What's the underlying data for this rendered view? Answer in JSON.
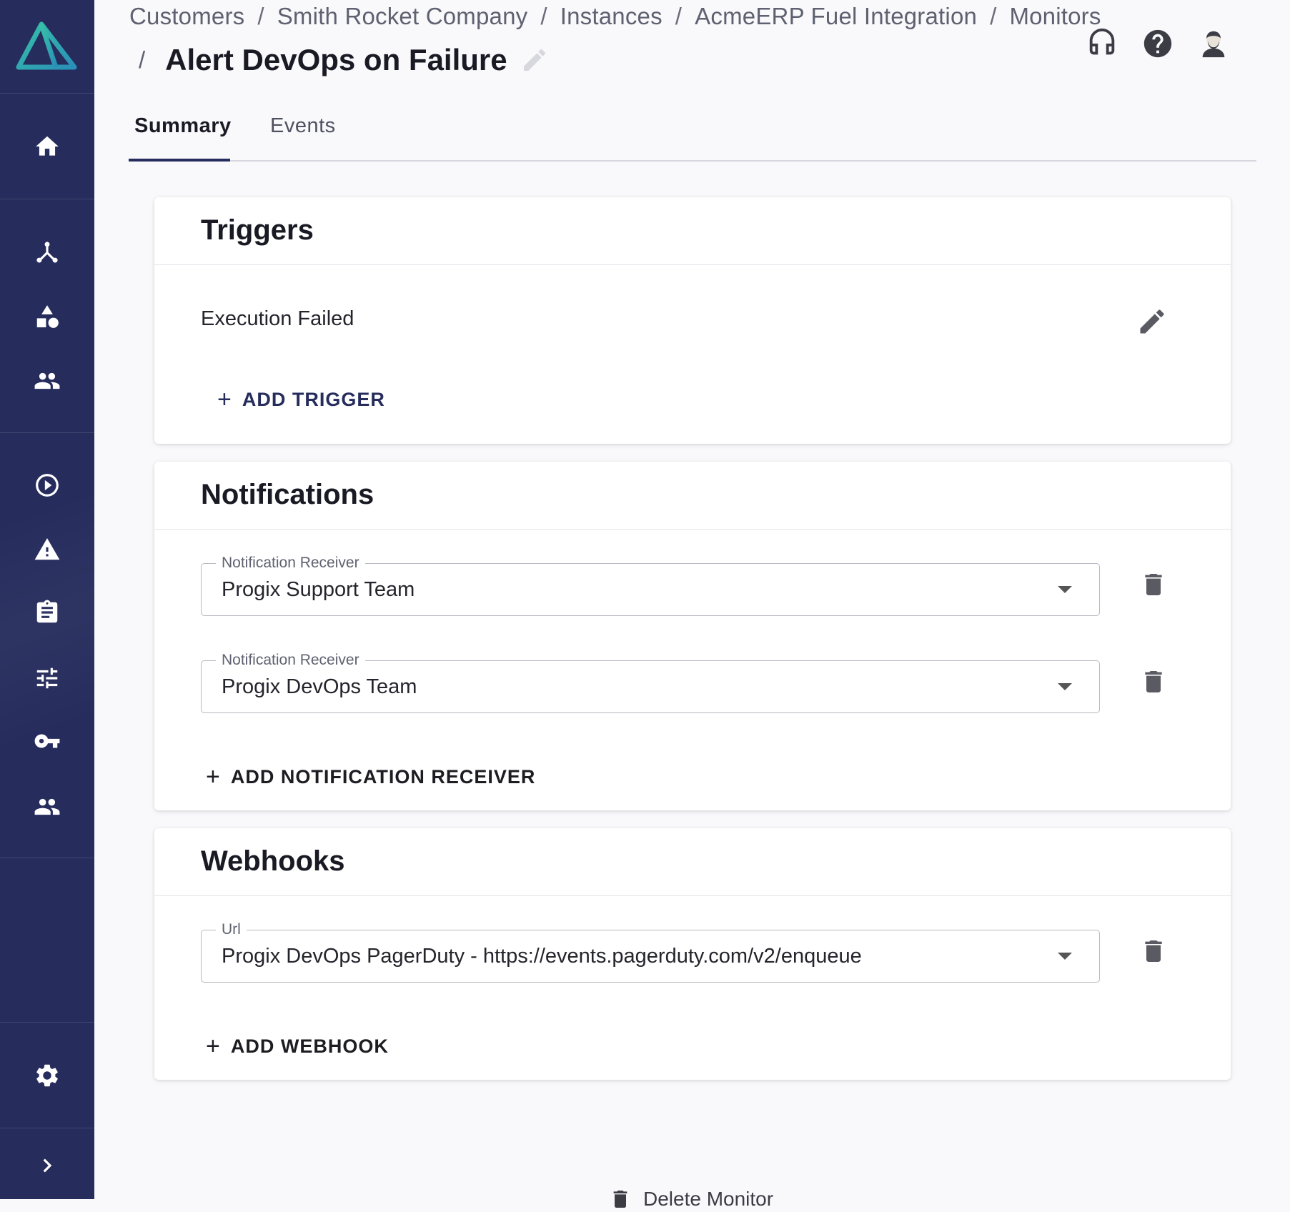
{
  "sidebar": {
    "logo": "prismatic-logo",
    "items": [
      {
        "name": "home",
        "icon": "home-icon"
      },
      {
        "name": "integrations",
        "icon": "integrations-icon"
      },
      {
        "name": "components",
        "icon": "shapes-icon"
      },
      {
        "name": "customers",
        "icon": "people-icon"
      },
      {
        "name": "executions",
        "icon": "play-circle-icon"
      },
      {
        "name": "alerts",
        "icon": "warning-icon"
      },
      {
        "name": "logs",
        "icon": "clipboard-icon"
      },
      {
        "name": "settings-sliders",
        "icon": "sliders-icon"
      },
      {
        "name": "credentials",
        "icon": "key-icon"
      },
      {
        "name": "users",
        "icon": "people-icon"
      },
      {
        "name": "settings",
        "icon": "gear-icon"
      },
      {
        "name": "expand",
        "icon": "chevron-right-icon"
      }
    ],
    "bg_color": "#262c5c"
  },
  "breadcrumb": {
    "items": [
      "Customers",
      "Smith Rocket Company",
      "Instances",
      "AcmeERP Fuel Integration",
      "Monitors"
    ],
    "separator": "/"
  },
  "header": {
    "title": "Alert DevOps on Failure",
    "icons": [
      "headset-icon",
      "help-icon",
      "user-avatar-icon"
    ]
  },
  "tabs": [
    {
      "label": "Summary",
      "active": true
    },
    {
      "label": "Events",
      "active": false
    }
  ],
  "triggers": {
    "title": "Triggers",
    "items": [
      {
        "label": "Execution Failed"
      }
    ],
    "add_label": "ADD TRIGGER"
  },
  "notifications": {
    "title": "Notifications",
    "receivers": [
      {
        "label": "Notification Receiver",
        "value": "Progix Support Team"
      },
      {
        "label": "Notification Receiver",
        "value": "Progix DevOps Team"
      }
    ],
    "add_label": "ADD NOTIFICATION RECEIVER"
  },
  "webhooks": {
    "title": "Webhooks",
    "items": [
      {
        "label": "Url",
        "value": "Progix DevOps PagerDuty - https://events.pagerduty.com/v2/enqueue"
      }
    ],
    "add_label": "ADD WEBHOOK"
  },
  "footer": {
    "delete_label": "Delete Monitor"
  },
  "colors": {
    "accent": "#262c5c",
    "logo_teal": "#2bb5a8"
  }
}
